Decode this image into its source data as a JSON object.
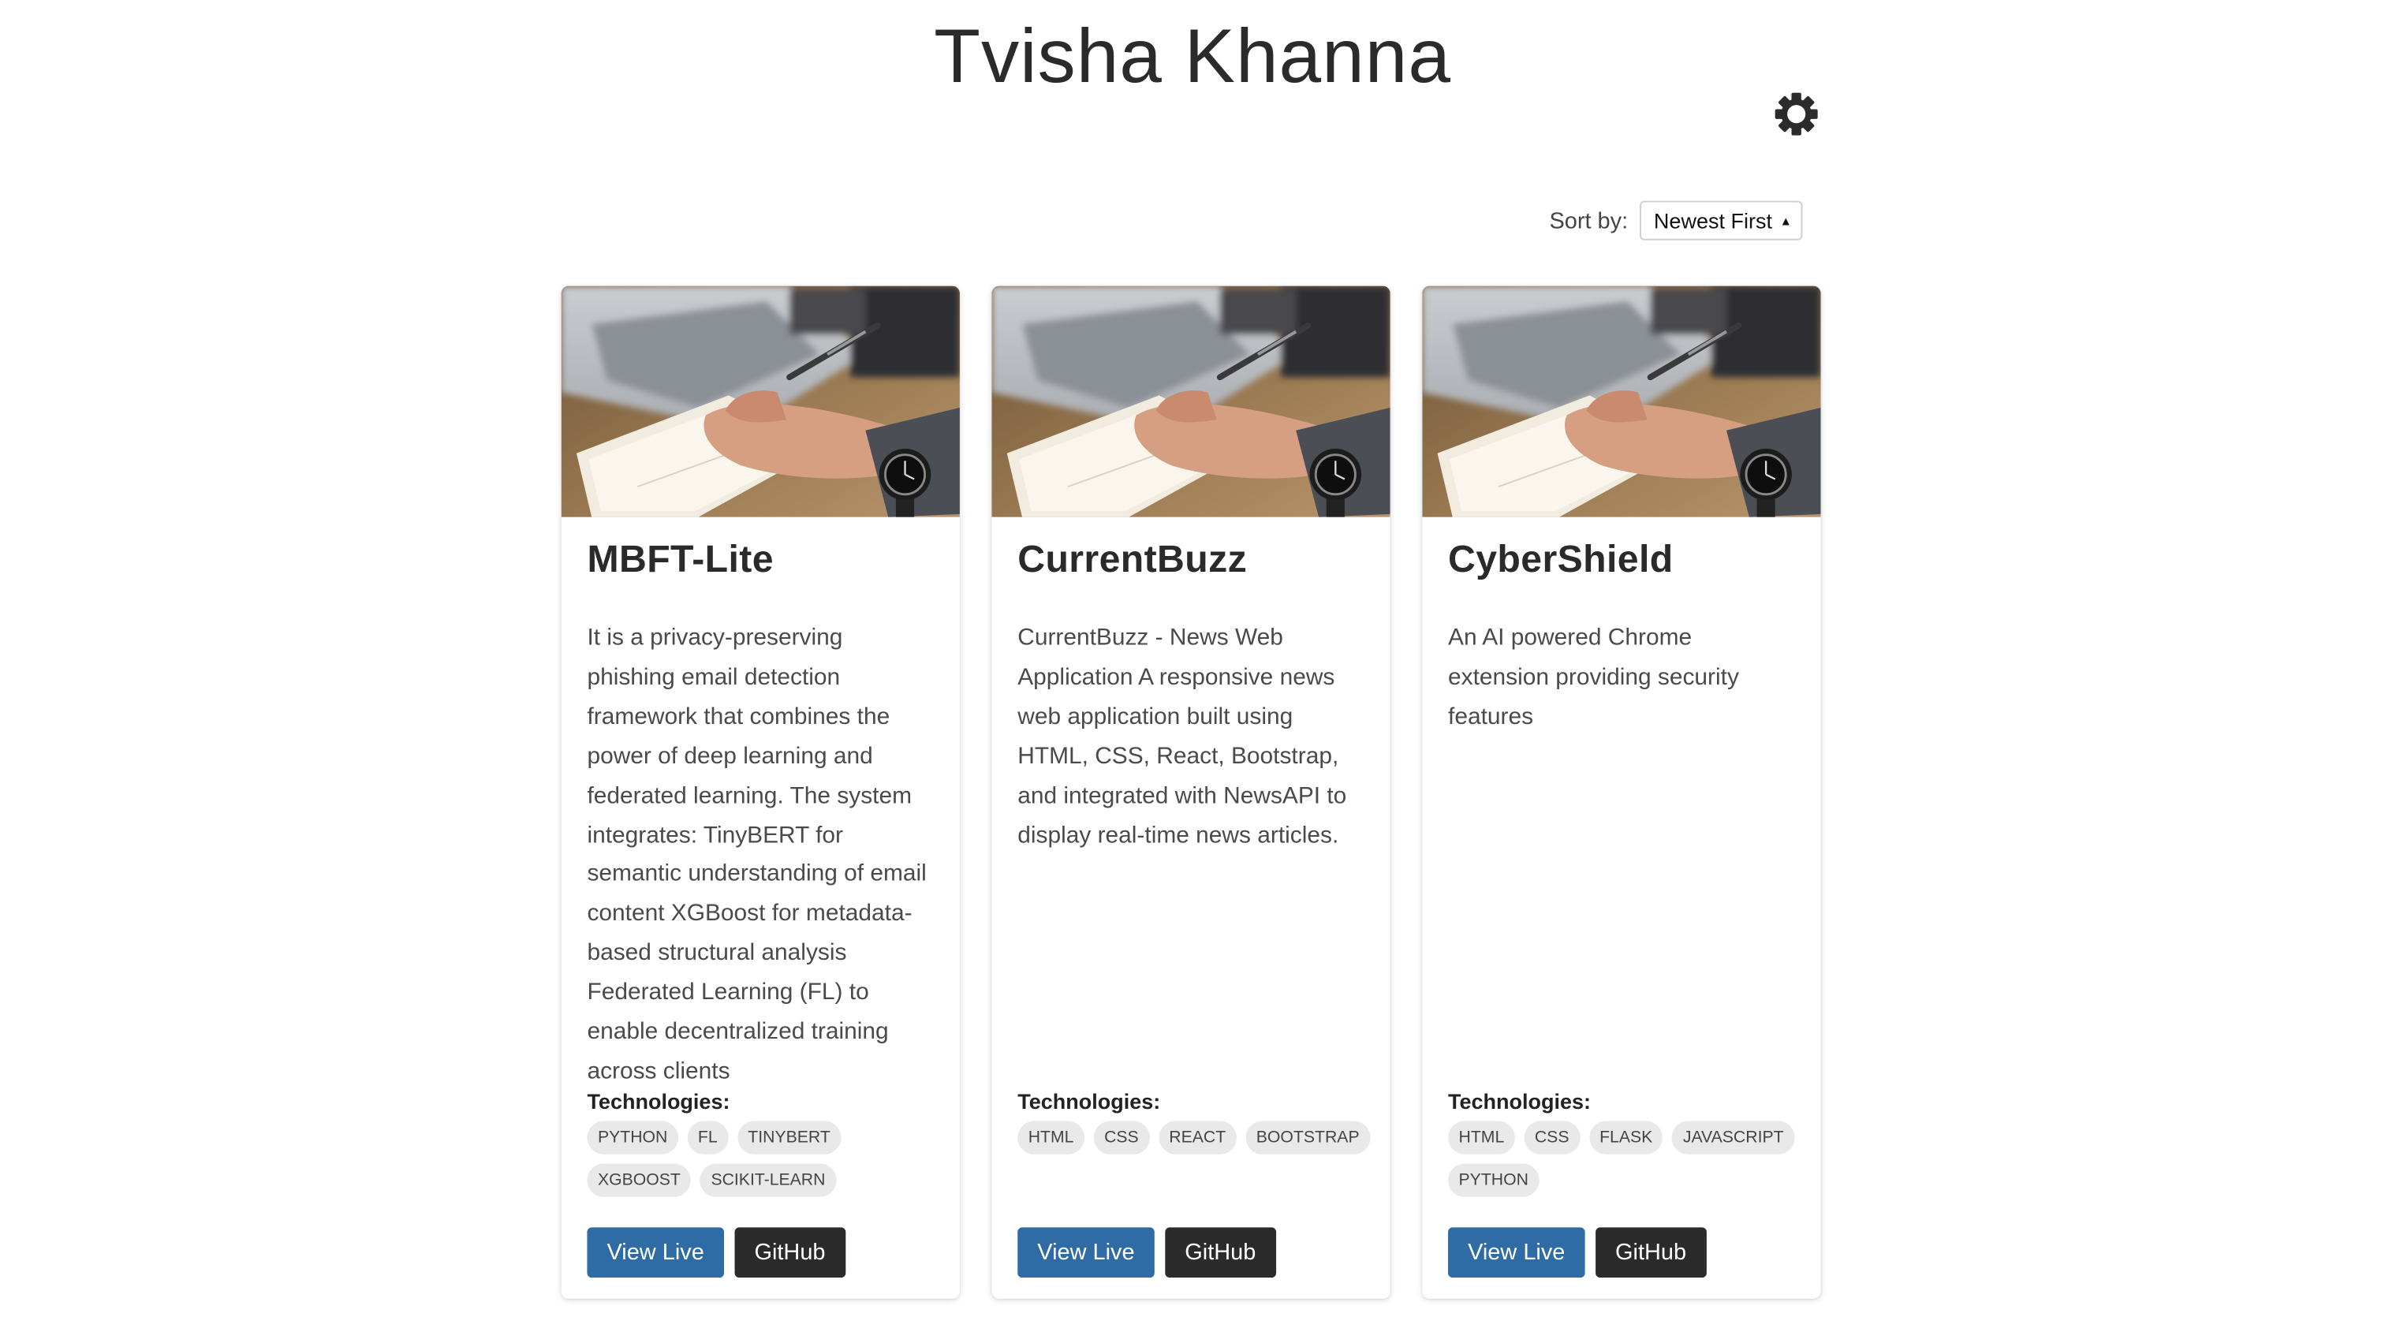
{
  "header": {
    "title": "Tvisha Khanna",
    "theme_icon": "gear-icon"
  },
  "sort": {
    "label": "Sort by:",
    "selected": "Newest First",
    "caret_icon": "caret-icon"
  },
  "colors": {
    "view_live_button": "#2f6ca6",
    "github_button": "#2b2b2b",
    "tag_background": "#e9e9e9"
  },
  "technologies_heading": "Technologies:",
  "projects": [
    {
      "title": "MBFT-Lite",
      "description": "It is a privacy-preserving phishing email detection framework that combines the power of deep learning and federated learning. The system integrates: TinyBERT for semantic understanding of email content XGBoost for metadata-based structural analysis Federated Learning (FL) to enable decentralized training across clients",
      "tags": [
        "PYTHON",
        "FL",
        "TINYBERT",
        "XGBOOST",
        "SCIKIT-LEARN"
      ],
      "live_label": "View Live",
      "github_label": "GitHub"
    },
    {
      "title": "CurrentBuzz",
      "description": "CurrentBuzz - News Web Application A responsive news web application built using HTML, CSS, React, Bootstrap, and integrated with NewsAPI to display real-time news articles.",
      "tags": [
        "HTML",
        "CSS",
        "REACT",
        "BOOTSTRAP"
      ],
      "live_label": "View Live",
      "github_label": "GitHub"
    },
    {
      "title": "CyberShield",
      "description": "An AI powered Chrome extension providing security features",
      "tags": [
        "HTML",
        "CSS",
        "FLASK",
        "JAVASCRIPT",
        "PYTHON"
      ],
      "live_label": "View Live",
      "github_label": "GitHub"
    }
  ]
}
